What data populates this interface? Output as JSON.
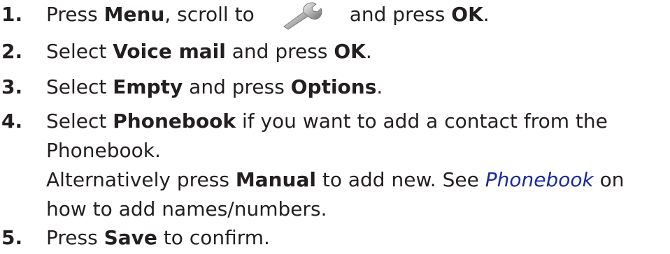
{
  "steps": [
    {
      "number": "1.",
      "parts": {
        "a": "Press ",
        "b": "Menu",
        "c": ", scroll to",
        "icon": "wrench-icon",
        "d": "and press ",
        "e": "OK",
        "f": "."
      }
    },
    {
      "number": "2.",
      "parts": {
        "a": "Select ",
        "b": "Voice mail",
        "c": " and press ",
        "d": "OK",
        "e": "."
      }
    },
    {
      "number": "3.",
      "parts": {
        "a": "Select ",
        "b": "Empty",
        "c": " and press ",
        "d": "Options",
        "e": "."
      }
    },
    {
      "number": "4.",
      "line1": {
        "a": "Select ",
        "b": "Phonebook",
        "c": " if you want to add a contact from the"
      },
      "line2": "Phonebook.",
      "line3": {
        "a": "Alternatively press ",
        "b": "Manual",
        "c": " to add new. See ",
        "link": "Phonebook",
        "d": " on"
      },
      "line4": "how to add names/numbers."
    },
    {
      "number": "5.",
      "parts": {
        "a": "Press ",
        "b": "Save",
        "c": " to confirm."
      }
    }
  ]
}
